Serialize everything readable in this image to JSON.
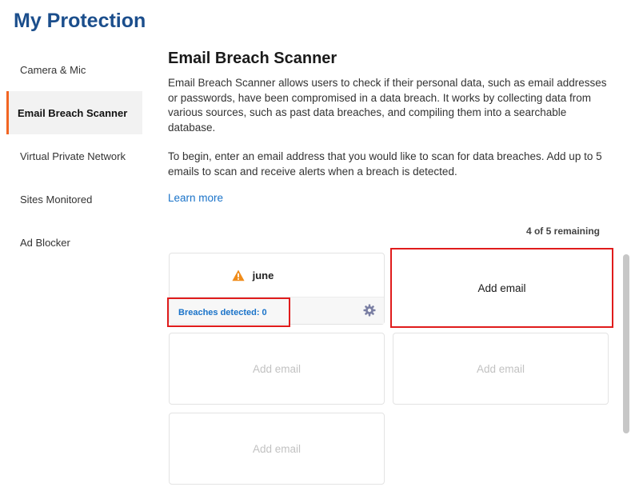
{
  "app": {
    "title": "My Protection"
  },
  "sidebar": {
    "items": [
      {
        "label": "Camera & Mic",
        "active": false
      },
      {
        "label": "Email Breach Scanner",
        "active": true
      },
      {
        "label": "Virtual Private Network",
        "active": false
      },
      {
        "label": "Sites Monitored",
        "active": false
      },
      {
        "label": "Ad Blocker",
        "active": false
      }
    ]
  },
  "main": {
    "title": "Email Breach Scanner",
    "description": "Email Breach Scanner allows users to check if their personal data, such as email addresses or passwords, have been compromised in a data breach. It works by collecting data from various sources, such as past data breaches, and compiling them into a searchable database.",
    "instructions": "To begin, enter an email address that you would like to scan for data breaches. Add up to 5 emails to scan and receive alerts when a breach is detected.",
    "learn_more": "Learn more",
    "remaining": "4 of 5 remaining"
  },
  "emails": {
    "monitored": {
      "name": "june",
      "warning_icon": "warning-icon",
      "breaches": "Breaches detected: 0",
      "settings_icon": "gear-icon"
    },
    "add_label": "Add email"
  },
  "colors": {
    "accent": "#f26522",
    "title": "#1b4e8c",
    "link": "#1a73c9",
    "highlight": "#e01c1c",
    "warning": "#f08c1a"
  }
}
